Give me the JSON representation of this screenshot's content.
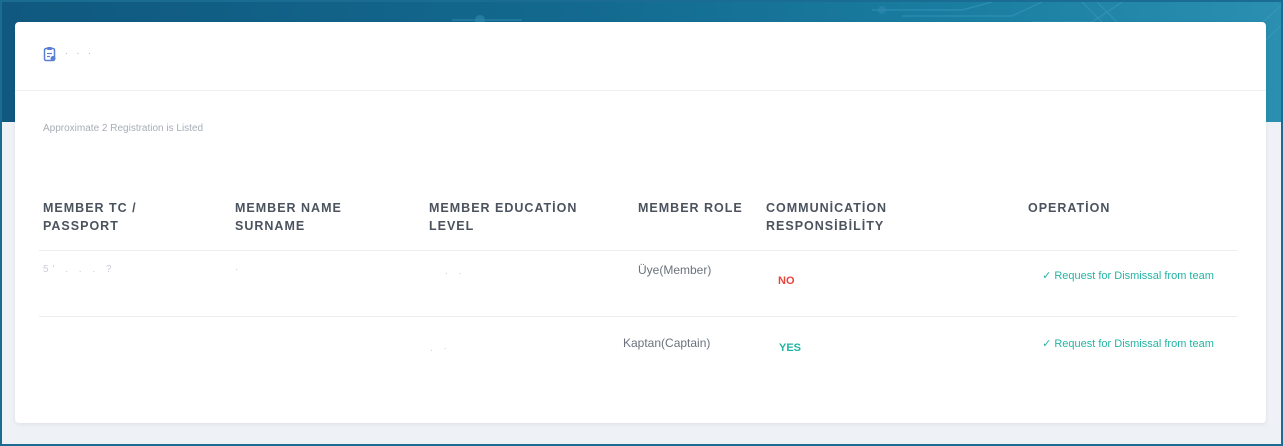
{
  "header": {
    "title": ". . .",
    "icon": "clipboard-icon"
  },
  "summary": {
    "registration_count_text": "Approximate 2 Registration is Listed"
  },
  "table": {
    "columns": [
      {
        "line1": "MEMBER TC /",
        "line2": "PASSPORT"
      },
      {
        "line1": "MEMBER NAME",
        "line2": "SURNAME"
      },
      {
        "line1": "MEMBER EDUCATİON",
        "line2": "LEVEL"
      },
      {
        "line1": "",
        "line2": "MEMBER ROLE"
      },
      {
        "line1": "COMMUNİCATİON",
        "line2": "RESPONSİBİLİTY"
      },
      {
        "line1": "",
        "line2": "OPERATİON"
      }
    ],
    "rows": [
      {
        "tc": "5' . . . ?",
        "name": "·",
        "education": ". .",
        "role": "Üye(Member)",
        "communication": "NO",
        "operation": "Request for Dismissal from team"
      },
      {
        "tc": "",
        "name": "",
        "education": ". ·",
        "role": "Kaptan(Captain)",
        "communication": "YES",
        "operation": "Request for Dismissal from team"
      }
    ]
  },
  "colors": {
    "banner": "#13698f",
    "no": "#e8453c",
    "yes": "#1fb5a4",
    "link": "#24b4a5"
  }
}
